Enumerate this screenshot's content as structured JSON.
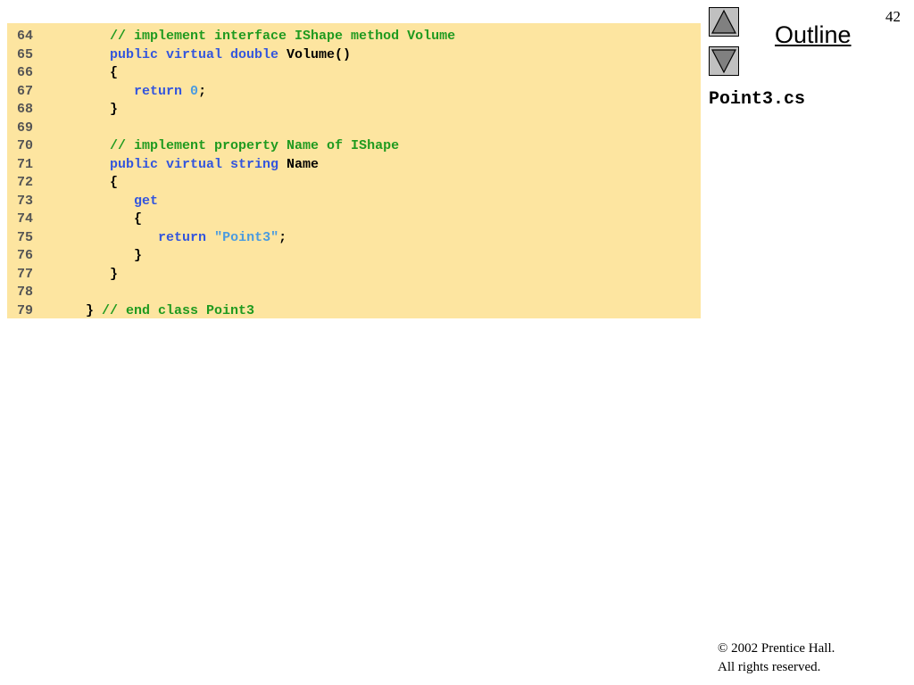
{
  "slide": {
    "page_number": "42",
    "outline_label": "Outline",
    "file_name": "Point3.cs",
    "copyright_line1": "© 2002 Prentice Hall.",
    "copyright_line2": "All rights reserved."
  },
  "navigation": {
    "up_icon": "triangle-up-icon",
    "down_icon": "triangle-down-icon"
  },
  "colors": {
    "code_background": "#FDE5A0",
    "keyword": "#3355DD",
    "comment": "#1F9A1F",
    "string_literal": "#4A9BE0",
    "line_number": "#555555"
  },
  "code": {
    "lines": [
      {
        "num": "64",
        "tokens": [
          {
            "t": "      ",
            "k": "tx"
          },
          {
            "t": "// implement interface IShape method Volume",
            "k": "cm"
          }
        ]
      },
      {
        "num": "65",
        "tokens": [
          {
            "t": "      ",
            "k": "tx"
          },
          {
            "t": "public virtual double",
            "k": "kw"
          },
          {
            "t": " Volume()",
            "k": "tx"
          }
        ]
      },
      {
        "num": "66",
        "tokens": [
          {
            "t": "      {",
            "k": "tx"
          }
        ]
      },
      {
        "num": "67",
        "tokens": [
          {
            "t": "         ",
            "k": "tx"
          },
          {
            "t": "return",
            "k": "kw"
          },
          {
            "t": " ",
            "k": "tx"
          },
          {
            "t": "0",
            "k": "num"
          },
          {
            "t": ";",
            "k": "tx"
          }
        ]
      },
      {
        "num": "68",
        "tokens": [
          {
            "t": "      }",
            "k": "tx"
          }
        ]
      },
      {
        "num": "69",
        "tokens": []
      },
      {
        "num": "70",
        "tokens": [
          {
            "t": "      ",
            "k": "tx"
          },
          {
            "t": "// implement property Name of IShape",
            "k": "cm"
          }
        ]
      },
      {
        "num": "71",
        "tokens": [
          {
            "t": "      ",
            "k": "tx"
          },
          {
            "t": "public virtual string",
            "k": "kw"
          },
          {
            "t": " Name",
            "k": "tx"
          }
        ]
      },
      {
        "num": "72",
        "tokens": [
          {
            "t": "      {",
            "k": "tx"
          }
        ]
      },
      {
        "num": "73",
        "tokens": [
          {
            "t": "         ",
            "k": "tx"
          },
          {
            "t": "get",
            "k": "kw"
          }
        ]
      },
      {
        "num": "74",
        "tokens": [
          {
            "t": "         {",
            "k": "tx"
          }
        ]
      },
      {
        "num": "75",
        "tokens": [
          {
            "t": "            ",
            "k": "tx"
          },
          {
            "t": "return",
            "k": "kw"
          },
          {
            "t": " ",
            "k": "tx"
          },
          {
            "t": "\"Point3\"",
            "k": "str"
          },
          {
            "t": ";",
            "k": "tx"
          }
        ]
      },
      {
        "num": "76",
        "tokens": [
          {
            "t": "         }",
            "k": "tx"
          }
        ]
      },
      {
        "num": "77",
        "tokens": [
          {
            "t": "      }",
            "k": "tx"
          }
        ]
      },
      {
        "num": "78",
        "tokens": []
      },
      {
        "num": "79",
        "tokens": [
          {
            "t": "   } ",
            "k": "tx"
          },
          {
            "t": "// end class Point3",
            "k": "cm"
          }
        ]
      }
    ]
  }
}
